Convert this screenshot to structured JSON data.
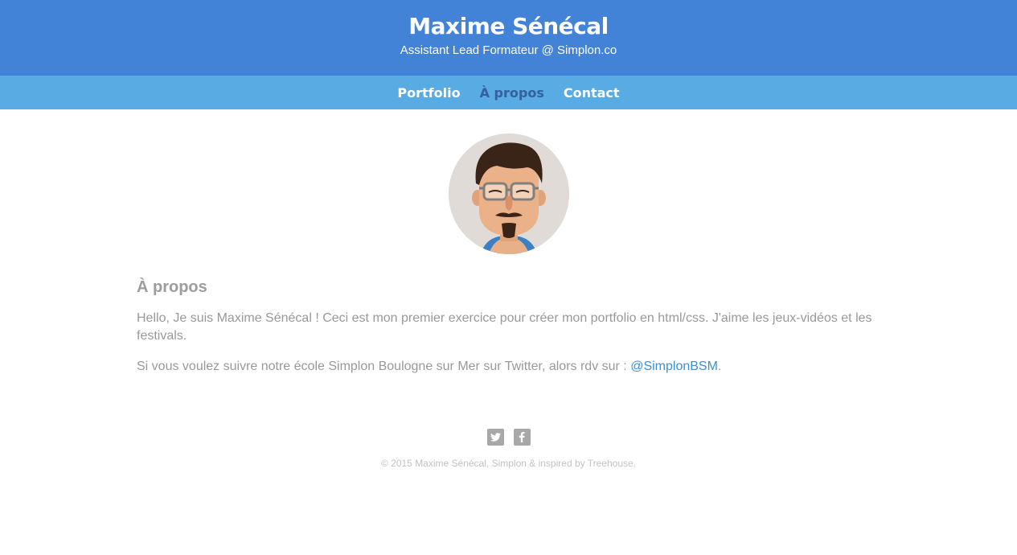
{
  "header": {
    "title": "Maxime Sénécal",
    "subtitle": "Assistant Lead Formateur @ Simplon.co"
  },
  "nav": {
    "items": [
      {
        "label": "Portfolio",
        "active": false
      },
      {
        "label": "À propos",
        "active": true
      },
      {
        "label": "Contact",
        "active": false
      }
    ]
  },
  "about": {
    "avatar_icon": "avatar-illustration",
    "title": "À propos",
    "paragraph1": "Hello, Je suis Maxime Sénécal ! Ceci est mon premier exercice pour créer mon portfolio en html/css. J'aime les jeux-vidéos et les festivals.",
    "paragraph2_prefix": "Si vous voulez suivre notre école Simplon Boulogne sur Mer sur Twitter, alors rdv sur : ",
    "paragraph2_link": "@SimplonBSM",
    "paragraph2_suffix": "."
  },
  "footer": {
    "icons": [
      "twitter-icon",
      "facebook-icon"
    ],
    "copyright": "© 2015 Maxime Sénécal, Simplon & inspired by Treehouse."
  },
  "colors": {
    "header_bg": "#4283d7",
    "nav_bg": "#58abe3",
    "nav_active": "#34609e",
    "link": "#3b8fd6"
  }
}
